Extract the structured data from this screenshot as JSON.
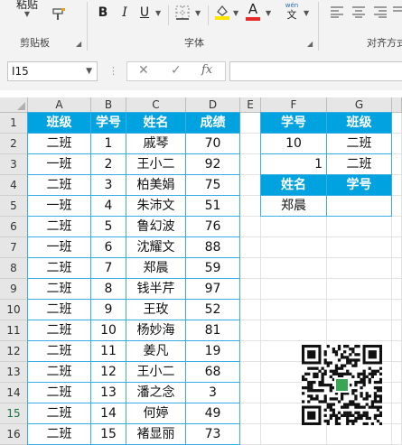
{
  "ribbon": {
    "paste_label": "粘贴",
    "clipboard_label": "剪贴板",
    "font_label": "字体",
    "align_label": "对齐方式",
    "bold": "B",
    "italic": "I",
    "underline": "U",
    "font_color_letter": "A",
    "phonetic_top": "wén",
    "phonetic_bottom": "文",
    "font_color": "#e52a2a",
    "highlight_color": "#ffe600"
  },
  "formula_bar": {
    "name_box": "I15",
    "cancel_icon": "✕",
    "enter_icon": "✓",
    "fx_label": "fx",
    "content": ""
  },
  "columns": [
    "A",
    "B",
    "C",
    "D",
    "E",
    "F",
    "G"
  ],
  "rows": [
    "1",
    "2",
    "3",
    "4",
    "5",
    "6",
    "7",
    "8",
    "9",
    "10",
    "11",
    "12",
    "13",
    "14",
    "15",
    "16"
  ],
  "main_table": {
    "headers": [
      "班级",
      "学号",
      "姓名",
      "成绩"
    ],
    "rows": [
      [
        "二班",
        "1",
        "戚琴",
        "70"
      ],
      [
        "一班",
        "2",
        "王小二",
        "92"
      ],
      [
        "二班",
        "3",
        "柏美娟",
        "75"
      ],
      [
        "一班",
        "4",
        "朱沛文",
        "51"
      ],
      [
        "二班",
        "5",
        "鲁幻波",
        "76"
      ],
      [
        "一班",
        "6",
        "沈耀文",
        "88"
      ],
      [
        "二班",
        "7",
        "郑晨",
        "59"
      ],
      [
        "二班",
        "8",
        "钱半芹",
        "97"
      ],
      [
        "二班",
        "9",
        "王玫",
        "52"
      ],
      [
        "二班",
        "10",
        "杨妙海",
        "81"
      ],
      [
        "二班",
        "11",
        "姜凡",
        "19"
      ],
      [
        "二班",
        "12",
        "王小二",
        "68"
      ],
      [
        "二班",
        "13",
        "潘之念",
        "3"
      ],
      [
        "二班",
        "14",
        "何婷",
        "49"
      ],
      [
        "二班",
        "15",
        "褚显丽",
        "73"
      ]
    ]
  },
  "lookup": {
    "f1": "学号",
    "g1": "班级",
    "f2": "10",
    "g2": "二班",
    "f3": "1",
    "g3": "二班",
    "f4": "姓名",
    "g4": "学号",
    "f5": "郑晨",
    "g5": ""
  },
  "colors": {
    "header_fill": "#00a3e0",
    "border": "#3aaee0"
  }
}
